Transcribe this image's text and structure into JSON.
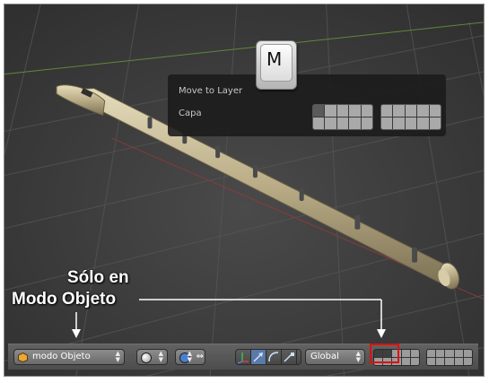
{
  "popup": {
    "title": "Move to Layer",
    "capa_label": "Capa"
  },
  "key": {
    "letter": "M"
  },
  "annotation": {
    "line1": "Sólo en",
    "line2": "Modo Objeto"
  },
  "toolbar": {
    "mode_label": "modo Objeto",
    "orientation_label": "Global"
  }
}
